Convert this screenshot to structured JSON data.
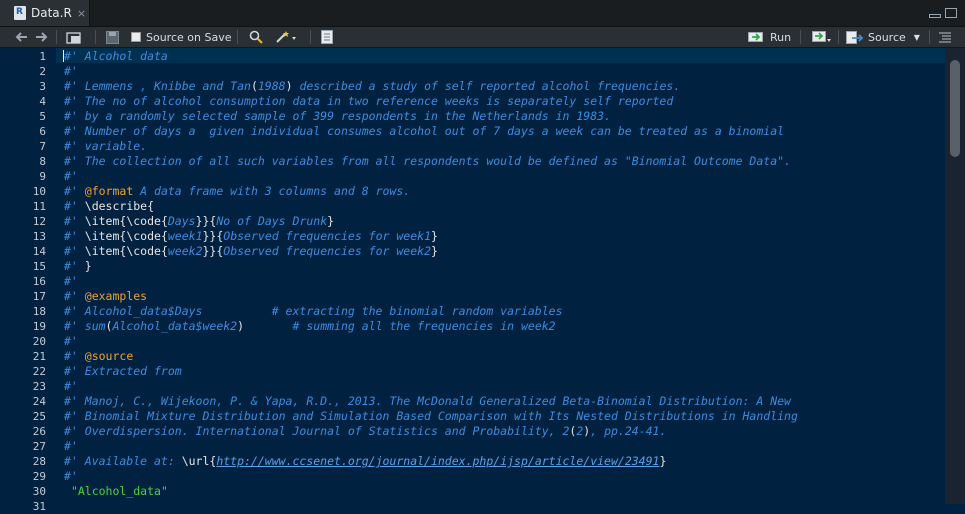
{
  "tab": {
    "filename": "Data.R",
    "close": "×"
  },
  "toolbar": {
    "source_on_save": "Source on Save",
    "run": "Run",
    "source": "Source"
  },
  "lines": [
    {
      "n": "1",
      "segs": [
        {
          "c": "cm",
          "t": "#' Alcohol data"
        }
      ]
    },
    {
      "n": "2",
      "segs": [
        {
          "c": "cm",
          "t": "#'"
        }
      ]
    },
    {
      "n": "3",
      "segs": [
        {
          "c": "cm",
          "t": "#' Lemmens , Knibbe and Tan"
        },
        {
          "c": "plain",
          "t": "("
        },
        {
          "c": "cm",
          "t": "1988"
        },
        {
          "c": "plain",
          "t": ")"
        },
        {
          "c": "cm",
          "t": " described a study of self reported alcohol frequencies."
        }
      ]
    },
    {
      "n": "4",
      "segs": [
        {
          "c": "cm",
          "t": "#' The no of alcohol consumption data in two reference weeks is separately self reported"
        }
      ]
    },
    {
      "n": "5",
      "segs": [
        {
          "c": "cm",
          "t": "#' by a randomly selected sample of 399 respondents in the Netherlands in 1983."
        }
      ]
    },
    {
      "n": "6",
      "segs": [
        {
          "c": "cm",
          "t": "#' Number of days a  given individual consumes alcohol out of 7 days a week can be treated as a binomial"
        }
      ]
    },
    {
      "n": "7",
      "segs": [
        {
          "c": "cm",
          "t": "#' variable."
        }
      ]
    },
    {
      "n": "8",
      "segs": [
        {
          "c": "cm",
          "t": "#' The collection of all such variables from all respondents would be defined as \"Binomial Outcome Data\"."
        }
      ]
    },
    {
      "n": "9",
      "segs": [
        {
          "c": "cm",
          "t": "#'"
        }
      ]
    },
    {
      "n": "10",
      "segs": [
        {
          "c": "cm",
          "t": "#' "
        },
        {
          "c": "kw",
          "t": "@format"
        },
        {
          "c": "cm",
          "t": " A data frame with 3 columns and 8 rows."
        }
      ]
    },
    {
      "n": "11",
      "segs": [
        {
          "c": "cm",
          "t": "#' "
        },
        {
          "c": "plain",
          "t": "\\describe{"
        }
      ]
    },
    {
      "n": "12",
      "segs": [
        {
          "c": "cm",
          "t": "#' "
        },
        {
          "c": "plain",
          "t": "\\item{\\code{"
        },
        {
          "c": "cm",
          "t": "Days"
        },
        {
          "c": "plain",
          "t": "}}{"
        },
        {
          "c": "cm",
          "t": "No of Days Drunk"
        },
        {
          "c": "plain",
          "t": "}"
        }
      ]
    },
    {
      "n": "13",
      "segs": [
        {
          "c": "cm",
          "t": "#' "
        },
        {
          "c": "plain",
          "t": "\\item{\\code{"
        },
        {
          "c": "cm",
          "t": "week1"
        },
        {
          "c": "plain",
          "t": "}}{"
        },
        {
          "c": "cm",
          "t": "Observed frequencies for week1"
        },
        {
          "c": "plain",
          "t": "}"
        }
      ]
    },
    {
      "n": "14",
      "segs": [
        {
          "c": "cm",
          "t": "#' "
        },
        {
          "c": "plain",
          "t": "\\item{\\code{"
        },
        {
          "c": "cm",
          "t": "week2"
        },
        {
          "c": "plain",
          "t": "}}{"
        },
        {
          "c": "cm",
          "t": "Observed frequencies for week2"
        },
        {
          "c": "plain",
          "t": "}"
        }
      ]
    },
    {
      "n": "15",
      "segs": [
        {
          "c": "cm",
          "t": "#' "
        },
        {
          "c": "plain",
          "t": "}"
        }
      ]
    },
    {
      "n": "16",
      "segs": [
        {
          "c": "cm",
          "t": "#'"
        }
      ]
    },
    {
      "n": "17",
      "segs": [
        {
          "c": "cm",
          "t": "#' "
        },
        {
          "c": "kw",
          "t": "@examples"
        }
      ]
    },
    {
      "n": "18",
      "segs": [
        {
          "c": "cm",
          "t": "#' Alcohol_data$Days          # extracting the binomial random variables"
        }
      ]
    },
    {
      "n": "19",
      "segs": [
        {
          "c": "cm",
          "t": "#' sum"
        },
        {
          "c": "plain",
          "t": "("
        },
        {
          "c": "cm",
          "t": "Alcohol_data$week2"
        },
        {
          "c": "plain",
          "t": ")"
        },
        {
          "c": "cm",
          "t": "       # summing all the frequencies in week2"
        }
      ]
    },
    {
      "n": "20",
      "segs": [
        {
          "c": "cm",
          "t": "#'"
        }
      ]
    },
    {
      "n": "21",
      "segs": [
        {
          "c": "cm",
          "t": "#' "
        },
        {
          "c": "kw",
          "t": "@source"
        }
      ]
    },
    {
      "n": "22",
      "segs": [
        {
          "c": "cm",
          "t": "#' Extracted from"
        }
      ]
    },
    {
      "n": "23",
      "segs": [
        {
          "c": "cm",
          "t": "#'"
        }
      ]
    },
    {
      "n": "24",
      "segs": [
        {
          "c": "cm",
          "t": "#' Manoj, C., Wijekoon, P. & Yapa, R.D., 2013. The McDonald Generalized Beta-Binomial Distribution: A New"
        }
      ]
    },
    {
      "n": "25",
      "segs": [
        {
          "c": "cm",
          "t": "#' Binomial Mixture Distribution and Simulation Based Comparison with Its Nested Distributions in Handling"
        }
      ]
    },
    {
      "n": "26",
      "segs": [
        {
          "c": "cm",
          "t": "#' Overdispersion. International Journal of Statistics and Probability, 2"
        },
        {
          "c": "plain",
          "t": "("
        },
        {
          "c": "cm",
          "t": "2"
        },
        {
          "c": "plain",
          "t": ")"
        },
        {
          "c": "cm",
          "t": ", pp.24-41."
        }
      ]
    },
    {
      "n": "27",
      "segs": [
        {
          "c": "cm",
          "t": "#'"
        }
      ]
    },
    {
      "n": "28",
      "segs": [
        {
          "c": "cm",
          "t": "#' Available at: "
        },
        {
          "c": "plain",
          "t": "\\url{"
        },
        {
          "c": "url",
          "t": "http://www.ccsenet.org/journal/index.php/ijsp/article/view/23491"
        },
        {
          "c": "plain",
          "t": "}"
        }
      ]
    },
    {
      "n": "29",
      "segs": [
        {
          "c": "cm",
          "t": "#'"
        }
      ]
    },
    {
      "n": "30",
      "segs": [
        {
          "c": "plain",
          "t": " "
        },
        {
          "c": "str",
          "t": "\"Alcohol_data\""
        }
      ]
    },
    {
      "n": "31",
      "segs": []
    }
  ]
}
